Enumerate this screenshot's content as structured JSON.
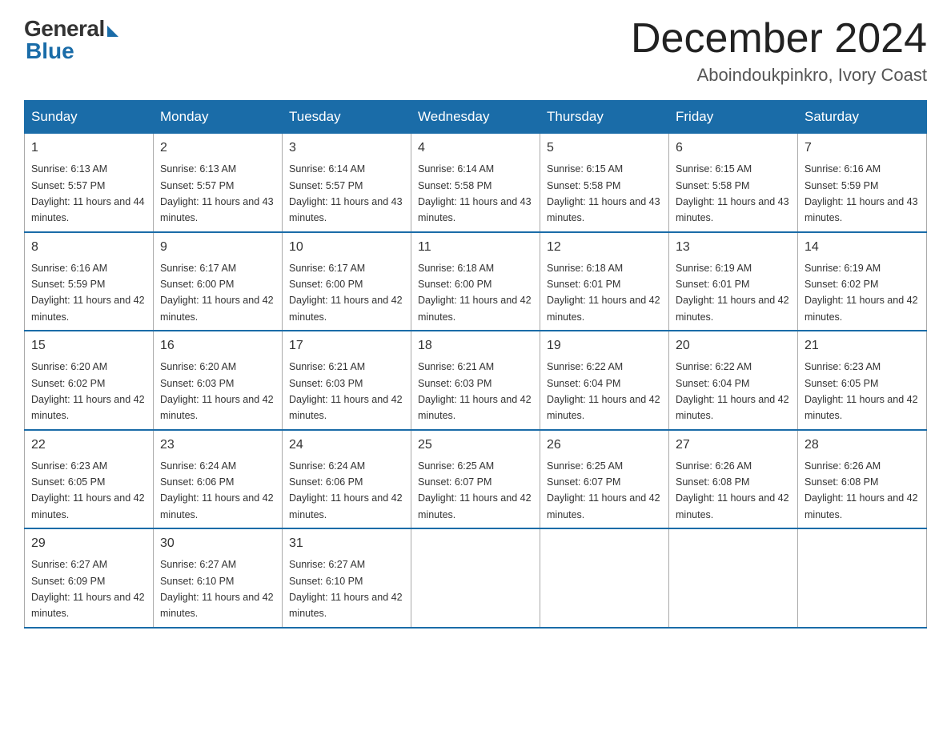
{
  "logo": {
    "general": "General",
    "blue": "Blue"
  },
  "title": "December 2024",
  "location": "Aboindoukpinkro, Ivory Coast",
  "days_of_week": [
    "Sunday",
    "Monday",
    "Tuesday",
    "Wednesday",
    "Thursday",
    "Friday",
    "Saturday"
  ],
  "weeks": [
    [
      {
        "day": "1",
        "sunrise": "6:13 AM",
        "sunset": "5:57 PM",
        "daylight": "11 hours and 44 minutes."
      },
      {
        "day": "2",
        "sunrise": "6:13 AM",
        "sunset": "5:57 PM",
        "daylight": "11 hours and 43 minutes."
      },
      {
        "day": "3",
        "sunrise": "6:14 AM",
        "sunset": "5:57 PM",
        "daylight": "11 hours and 43 minutes."
      },
      {
        "day": "4",
        "sunrise": "6:14 AM",
        "sunset": "5:58 PM",
        "daylight": "11 hours and 43 minutes."
      },
      {
        "day": "5",
        "sunrise": "6:15 AM",
        "sunset": "5:58 PM",
        "daylight": "11 hours and 43 minutes."
      },
      {
        "day": "6",
        "sunrise": "6:15 AM",
        "sunset": "5:58 PM",
        "daylight": "11 hours and 43 minutes."
      },
      {
        "day": "7",
        "sunrise": "6:16 AM",
        "sunset": "5:59 PM",
        "daylight": "11 hours and 43 minutes."
      }
    ],
    [
      {
        "day": "8",
        "sunrise": "6:16 AM",
        "sunset": "5:59 PM",
        "daylight": "11 hours and 42 minutes."
      },
      {
        "day": "9",
        "sunrise": "6:17 AM",
        "sunset": "6:00 PM",
        "daylight": "11 hours and 42 minutes."
      },
      {
        "day": "10",
        "sunrise": "6:17 AM",
        "sunset": "6:00 PM",
        "daylight": "11 hours and 42 minutes."
      },
      {
        "day": "11",
        "sunrise": "6:18 AM",
        "sunset": "6:00 PM",
        "daylight": "11 hours and 42 minutes."
      },
      {
        "day": "12",
        "sunrise": "6:18 AM",
        "sunset": "6:01 PM",
        "daylight": "11 hours and 42 minutes."
      },
      {
        "day": "13",
        "sunrise": "6:19 AM",
        "sunset": "6:01 PM",
        "daylight": "11 hours and 42 minutes."
      },
      {
        "day": "14",
        "sunrise": "6:19 AM",
        "sunset": "6:02 PM",
        "daylight": "11 hours and 42 minutes."
      }
    ],
    [
      {
        "day": "15",
        "sunrise": "6:20 AM",
        "sunset": "6:02 PM",
        "daylight": "11 hours and 42 minutes."
      },
      {
        "day": "16",
        "sunrise": "6:20 AM",
        "sunset": "6:03 PM",
        "daylight": "11 hours and 42 minutes."
      },
      {
        "day": "17",
        "sunrise": "6:21 AM",
        "sunset": "6:03 PM",
        "daylight": "11 hours and 42 minutes."
      },
      {
        "day": "18",
        "sunrise": "6:21 AM",
        "sunset": "6:03 PM",
        "daylight": "11 hours and 42 minutes."
      },
      {
        "day": "19",
        "sunrise": "6:22 AM",
        "sunset": "6:04 PM",
        "daylight": "11 hours and 42 minutes."
      },
      {
        "day": "20",
        "sunrise": "6:22 AM",
        "sunset": "6:04 PM",
        "daylight": "11 hours and 42 minutes."
      },
      {
        "day": "21",
        "sunrise": "6:23 AM",
        "sunset": "6:05 PM",
        "daylight": "11 hours and 42 minutes."
      }
    ],
    [
      {
        "day": "22",
        "sunrise": "6:23 AM",
        "sunset": "6:05 PM",
        "daylight": "11 hours and 42 minutes."
      },
      {
        "day": "23",
        "sunrise": "6:24 AM",
        "sunset": "6:06 PM",
        "daylight": "11 hours and 42 minutes."
      },
      {
        "day": "24",
        "sunrise": "6:24 AM",
        "sunset": "6:06 PM",
        "daylight": "11 hours and 42 minutes."
      },
      {
        "day": "25",
        "sunrise": "6:25 AM",
        "sunset": "6:07 PM",
        "daylight": "11 hours and 42 minutes."
      },
      {
        "day": "26",
        "sunrise": "6:25 AM",
        "sunset": "6:07 PM",
        "daylight": "11 hours and 42 minutes."
      },
      {
        "day": "27",
        "sunrise": "6:26 AM",
        "sunset": "6:08 PM",
        "daylight": "11 hours and 42 minutes."
      },
      {
        "day": "28",
        "sunrise": "6:26 AM",
        "sunset": "6:08 PM",
        "daylight": "11 hours and 42 minutes."
      }
    ],
    [
      {
        "day": "29",
        "sunrise": "6:27 AM",
        "sunset": "6:09 PM",
        "daylight": "11 hours and 42 minutes."
      },
      {
        "day": "30",
        "sunrise": "6:27 AM",
        "sunset": "6:10 PM",
        "daylight": "11 hours and 42 minutes."
      },
      {
        "day": "31",
        "sunrise": "6:27 AM",
        "sunset": "6:10 PM",
        "daylight": "11 hours and 42 minutes."
      },
      null,
      null,
      null,
      null
    ]
  ]
}
